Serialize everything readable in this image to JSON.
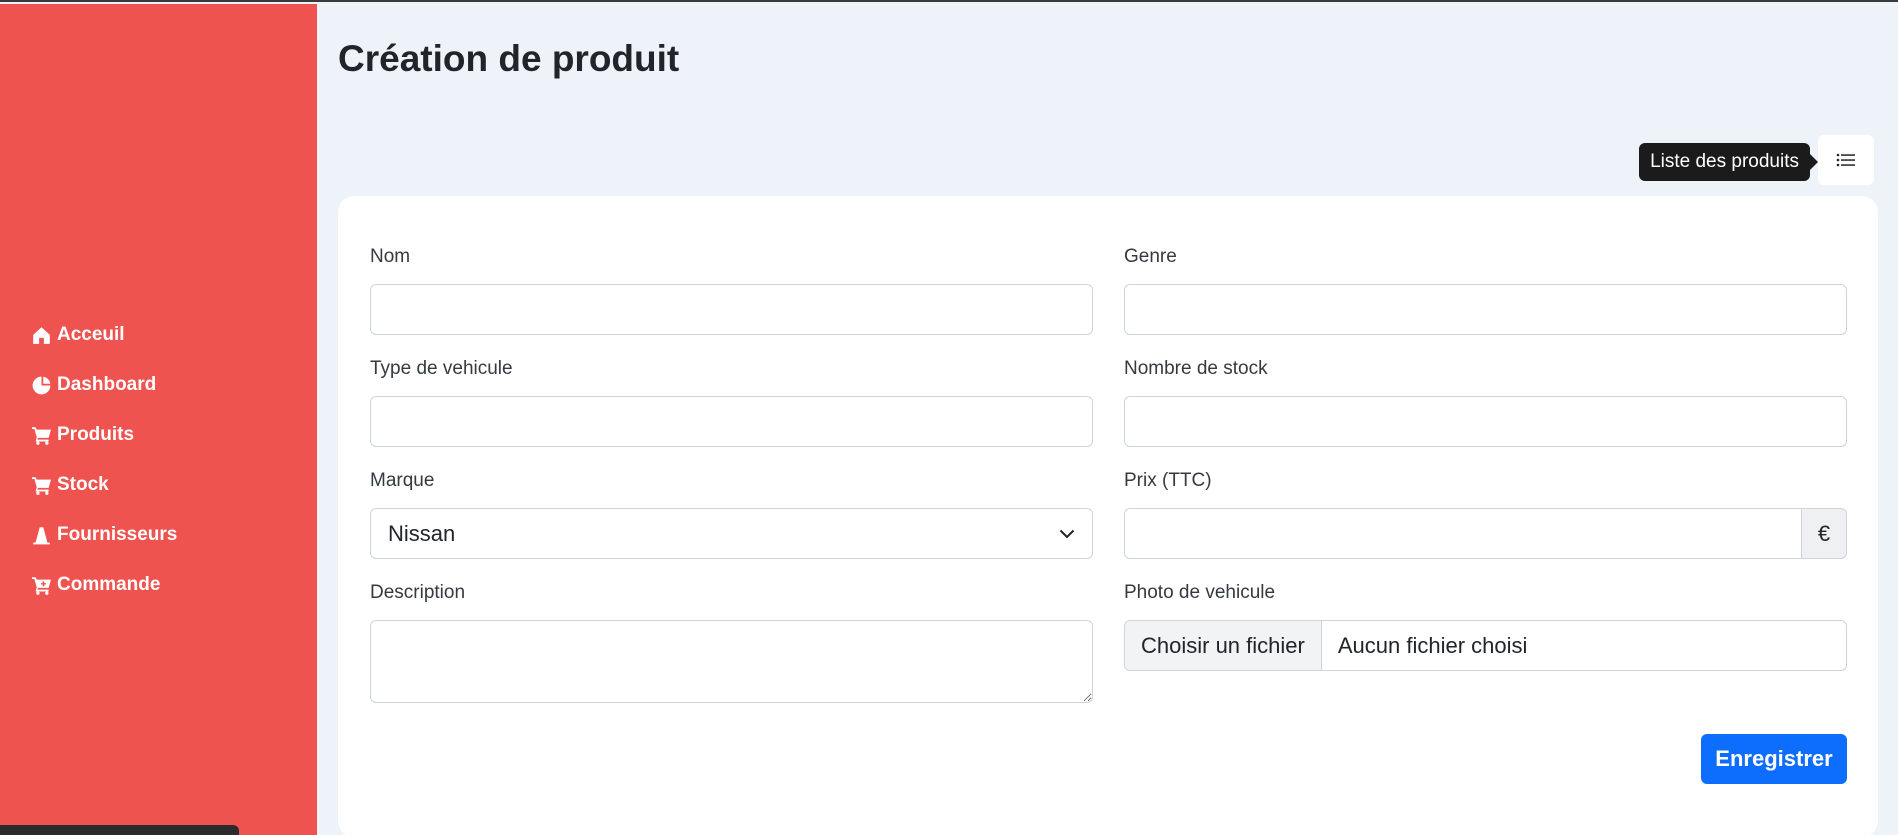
{
  "sidebar": {
    "items": [
      {
        "label": "Acceuil",
        "icon": "home-icon"
      },
      {
        "label": "Dashboard",
        "icon": "pie-chart-icon"
      },
      {
        "label": "Produits",
        "icon": "cart-icon"
      },
      {
        "label": "Stock",
        "icon": "cart-icon"
      },
      {
        "label": "Fournisseurs",
        "icon": "cone-icon"
      },
      {
        "label": "Commande",
        "icon": "cart-plus-icon"
      }
    ],
    "background": "#ef5350"
  },
  "page": {
    "title": "Création de produit",
    "list_tooltip": "Liste des produits",
    "list_button_icon": "list-icon"
  },
  "form": {
    "nom": {
      "label": "Nom",
      "value": "",
      "placeholder": ""
    },
    "genre": {
      "label": "Genre",
      "value": "",
      "placeholder": ""
    },
    "type_vehicule": {
      "label": "Type de vehicule",
      "value": "",
      "placeholder": ""
    },
    "nombre_stock": {
      "label": "Nombre de stock",
      "value": "",
      "placeholder": ""
    },
    "marque": {
      "label": "Marque",
      "selected": "Nissan"
    },
    "prix": {
      "label": "Prix (TTC)",
      "value": "",
      "currency": "€"
    },
    "description": {
      "label": "Description",
      "value": ""
    },
    "photo": {
      "label": "Photo de vehicule",
      "button": "Choisir un fichier",
      "status": "Aucun fichier choisi"
    },
    "submit_label": "Enregistrer"
  },
  "colors": {
    "accent": "#0d6efd",
    "page_bg": "#eef2f9"
  }
}
